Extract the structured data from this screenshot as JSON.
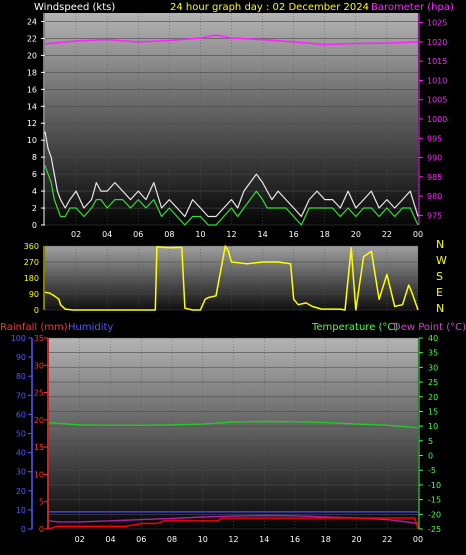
{
  "header": {
    "windspeed_title": "Windspeed (kts)",
    "graph_title": "24 hour graph day : 02 December 2024",
    "barometer_title": "Barometer (hpa)"
  },
  "bottom_header": {
    "rainfall_title": "Rainfall (mm)",
    "humidity_title": "Humidity",
    "temperature_title": "Temperature (°C)",
    "dewpoint_title": "Dew Point (°C)"
  },
  "colors": {
    "wind_avg": "#33dd33",
    "wind_gust": "#e8e8e8",
    "barometer": "#ff22ff",
    "direction": "#ffff00",
    "temperature": "#22cc22",
    "dewpoint": "#aa22aa",
    "humidity": "#4444ff",
    "rainfall": "#ff0000",
    "window_bg": "#000000",
    "humidity_axis": "#5555ff",
    "rain_axis": "#ff3333",
    "temp_axis": "#44ff44"
  },
  "chart_data": [
    {
      "type": "line",
      "panel": "wind_barometer",
      "x_ticks": [
        "02",
        "04",
        "06",
        "08",
        "10",
        "12",
        "14",
        "16",
        "18",
        "20",
        "22",
        "00"
      ],
      "xlim": [
        0,
        24
      ],
      "ylim_wind": [
        0,
        25
      ],
      "ylim_baro": [
        972.5,
        1027.5
      ],
      "left_ticks": [
        0,
        2,
        4,
        6,
        8,
        10,
        12,
        14,
        16,
        18,
        20,
        22,
        24
      ],
      "right_ticks": [
        975,
        980,
        985,
        990,
        995,
        1000,
        1005,
        1010,
        1015,
        1020,
        1025
      ],
      "series": [
        {
          "name": "Windspeed (kts)",
          "key": "wind_gust",
          "x": [
            0,
            0.2,
            0.4,
            0.6,
            0.8,
            1.0,
            1.3,
            1.6,
            2.0,
            2.5,
            3.0,
            3.3,
            3.6,
            4.0,
            4.5,
            5.0,
            5.5,
            6.0,
            6.5,
            7.0,
            7.5,
            8.0,
            8.5,
            9.0,
            9.5,
            10.0,
            10.5,
            11.0,
            11.5,
            12.0,
            12.4,
            12.8,
            13.2,
            13.6,
            14.0,
            14.3,
            14.6,
            15.0,
            15.5,
            16.0,
            16.5,
            17.0,
            17.5,
            18.0,
            18.5,
            19.0,
            19.5,
            20.0,
            20.5,
            21.0,
            21.5,
            22.0,
            22.5,
            23.0,
            23.5,
            24.0
          ],
          "y": [
            11,
            9,
            8,
            6,
            4,
            3,
            2,
            3,
            4,
            2,
            3,
            5,
            4,
            4,
            5,
            4,
            3,
            4,
            3,
            5,
            2,
            3,
            2,
            1,
            3,
            2,
            1,
            1,
            2,
            3,
            2,
            4,
            5,
            6,
            5,
            4,
            3,
            4,
            3,
            2,
            1,
            3,
            4,
            3,
            3,
            2,
            4,
            2,
            3,
            4,
            2,
            3,
            2,
            3,
            4,
            1
          ]
        },
        {
          "name": "Windspeed (kts)",
          "key": "wind_avg",
          "x": [
            0,
            0.2,
            0.4,
            0.6,
            0.8,
            1.0,
            1.3,
            1.6,
            2.0,
            2.5,
            3.0,
            3.3,
            3.6,
            4.0,
            4.5,
            5.0,
            5.5,
            6.0,
            6.5,
            7.0,
            7.5,
            8.0,
            8.5,
            9.0,
            9.5,
            10.0,
            10.5,
            11.0,
            11.5,
            12.0,
            12.4,
            12.8,
            13.2,
            13.6,
            14.0,
            14.3,
            14.6,
            15.0,
            15.5,
            16.0,
            16.5,
            17.0,
            17.5,
            18.0,
            18.5,
            19.0,
            19.5,
            20.0,
            20.5,
            21.0,
            21.5,
            22.0,
            22.5,
            23.0,
            23.5,
            24.0
          ],
          "y": [
            7,
            6,
            5,
            3,
            2,
            1,
            1,
            2,
            2,
            1,
            2,
            3,
            3,
            2,
            3,
            3,
            2,
            3,
            2,
            3,
            1,
            2,
            1,
            0,
            1,
            1,
            0,
            0,
            1,
            2,
            1,
            2,
            3,
            4,
            3,
            2,
            2,
            2,
            2,
            1,
            0,
            2,
            2,
            2,
            2,
            1,
            2,
            1,
            2,
            2,
            1,
            2,
            1,
            2,
            2,
            0
          ]
        },
        {
          "name": "Barometer (hpa)",
          "key": "barometer",
          "x": [
            0,
            2,
            4,
            6,
            8,
            10,
            11,
            12,
            14,
            16,
            18,
            20,
            22,
            24
          ],
          "y": [
            1019.5,
            1020.2,
            1020.6,
            1020.0,
            1020.4,
            1021.0,
            1021.8,
            1021.0,
            1020.6,
            1020.0,
            1019.3,
            1019.6,
            1019.7,
            1020.0
          ]
        }
      ]
    },
    {
      "type": "line",
      "panel": "wind_direction",
      "x_ticks": [
        "02",
        "04",
        "06",
        "08",
        "10",
        "12",
        "14",
        "16",
        "18",
        "20",
        "22",
        "00"
      ],
      "xlim": [
        0,
        24
      ],
      "ylim": [
        0,
        360
      ],
      "left_ticks": [
        0,
        90,
        180,
        270,
        360
      ],
      "right_labels": [
        "N",
        "W",
        "S",
        "E",
        "N"
      ],
      "series": [
        {
          "name": "Wind direction",
          "key": "direction",
          "x": [
            0,
            0.3,
            0.6,
            0.9,
            1.0,
            1.3,
            1.8,
            2.6,
            3.0,
            3.5,
            4.0,
            4.5,
            5.0,
            5.5,
            6.0,
            6.5,
            7.1,
            7.2,
            8.0,
            8.8,
            9.0,
            9.5,
            10.0,
            10.3,
            10.5,
            11.0,
            11.6,
            11.8,
            12.0,
            12.5,
            13.0,
            14.0,
            15.0,
            15.8,
            16.0,
            16.3,
            16.8,
            17.2,
            17.8,
            18.2,
            19.0,
            19.3,
            19.7,
            20.0,
            20.5,
            21.0,
            21.5,
            22.0,
            22.5,
            23.0,
            23.4,
            23.6,
            24.0
          ],
          "y": [
            100,
            95,
            80,
            60,
            30,
            5,
            0,
            0,
            0,
            0,
            0,
            0,
            0,
            0,
            0,
            0,
            0,
            355,
            350,
            352,
            10,
            0,
            0,
            60,
            70,
            80,
            360,
            330,
            270,
            265,
            260,
            270,
            270,
            260,
            60,
            30,
            40,
            20,
            5,
            5,
            5,
            0,
            350,
            0,
            300,
            330,
            60,
            200,
            20,
            30,
            140,
            100,
            0
          ]
        }
      ]
    },
    {
      "type": "line",
      "panel": "temperature_humidity_rain",
      "x_ticks": [
        "02",
        "04",
        "06",
        "08",
        "10",
        "12",
        "14",
        "16",
        "18",
        "20",
        "22",
        "00"
      ],
      "xlim": [
        0,
        24
      ],
      "ylim_temp": [
        -25,
        40
      ],
      "ylim_hum": [
        0,
        100
      ],
      "ylim_rain": [
        0,
        35
      ],
      "rain_ticks": [
        0,
        5,
        10,
        15,
        20,
        25,
        30,
        35
      ],
      "hum_ticks": [
        0,
        10,
        20,
        30,
        40,
        50,
        60,
        70,
        80,
        90,
        100
      ],
      "temp_ticks": [
        -25,
        -20,
        -15,
        -10,
        -5,
        0,
        5,
        10,
        15,
        20,
        25,
        30,
        35,
        40
      ],
      "series": [
        {
          "name": "Temperature (°C)",
          "key": "temperature",
          "x": [
            0,
            2,
            4,
            6,
            8,
            10,
            12,
            14,
            16,
            18,
            20,
            22,
            24
          ],
          "y": [
            11.2,
            10.4,
            10.3,
            10.3,
            10.4,
            10.7,
            11.4,
            11.6,
            11.5,
            11.2,
            10.7,
            10.3,
            9.5
          ]
        },
        {
          "name": "Dew Point (°C)",
          "key": "dewpoint",
          "x": [
            0,
            0.6,
            2,
            4,
            6,
            8,
            10,
            12,
            14,
            16,
            18,
            20,
            22,
            23,
            24
          ],
          "y": [
            -22.2,
            -22.6,
            -22.6,
            -22.2,
            -21.8,
            -21.4,
            -20.9,
            -20.6,
            -20.4,
            -20.5,
            -20.9,
            -21.2,
            -21.8,
            -22.4,
            -23.1
          ]
        },
        {
          "name": "Humidity",
          "key": "humidity",
          "x": [
            0,
            24
          ],
          "y": [
            9,
            9
          ]
        },
        {
          "name": "Rainfall (mm)",
          "key": "rainfall",
          "x": [
            0,
            0.5,
            1,
            2,
            3,
            4,
            5,
            6,
            7,
            7.5,
            8,
            9,
            10,
            11,
            11.2,
            12,
            13,
            14,
            16,
            17,
            18,
            20,
            22,
            23.8,
            24
          ],
          "y": [
            0,
            0.5,
            0.5,
            0.5,
            0.5,
            0.5,
            0.5,
            1,
            1,
            1.5,
            1.5,
            1.5,
            1.5,
            1.5,
            2,
            2,
            2,
            2,
            2,
            2,
            2,
            2,
            2,
            2,
            0
          ]
        }
      ]
    }
  ]
}
